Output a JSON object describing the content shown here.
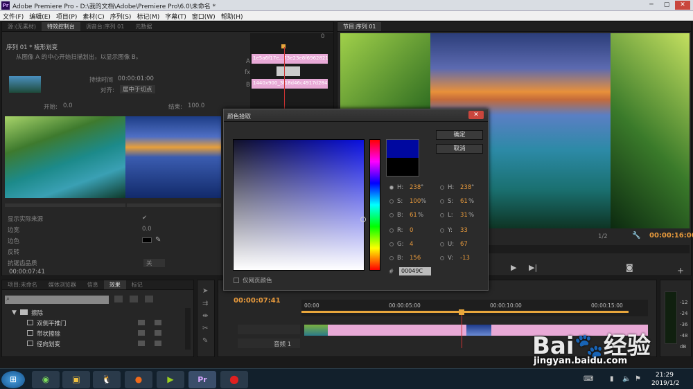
{
  "window": {
    "title": "Adobe Premiere Pro - D:\\我的文档\\Adobe\\Premiere Pro\\6.0\\未命名 *",
    "logo": "Pr"
  },
  "menu": [
    "文件(F)",
    "编辑(E)",
    "项目(P)",
    "素材(C)",
    "序列(S)",
    "标记(M)",
    "字幕(T)",
    "窗口(W)",
    "帮助(H)"
  ],
  "effect_controls": {
    "tabs": [
      "源:(无素材)",
      "特效控制台",
      "调音台:序列 01",
      "元数据"
    ],
    "header": "序列 01 * 棱形划变",
    "desc": "从图像 A 的中心开始扫描划出，以显示图像 B。",
    "duration_label": "持续时间",
    "duration": "00:00:01:00",
    "align_label": "对齐:",
    "align": "居中于切点",
    "clip_a": "1e5a6f17e...73e23e8f6962821",
    "clip_b": "1440x900_3f18d46c4917d2846",
    "mini_time": "0",
    "track_a": "A",
    "track_fx": "fx",
    "track_b": "B",
    "start_label": "开始:",
    "start_val": "0.0",
    "end_label": "结束:",
    "end_val": "100.0",
    "props": [
      {
        "name": "显示实际来源",
        "val": "✔"
      },
      {
        "name": "边宽",
        "val": "0.0"
      },
      {
        "name": "边色",
        "val": ""
      },
      {
        "name": "反转",
        "val": ""
      },
      {
        "name": "抗锯齿品质",
        "val": "关"
      }
    ],
    "time": "00:00:07:41"
  },
  "program": {
    "tab": "节目:序列 01",
    "fraction": "1/2",
    "time": "00:00:16:00"
  },
  "project": {
    "tabs": [
      "项目:未命名",
      "媒体浏览器",
      "信息",
      "效果",
      "标记"
    ],
    "folder": "擦除",
    "items": [
      "双侧平推门",
      "带状擦除",
      "径向划变"
    ]
  },
  "timeline": {
    "time": "00:00:07:41",
    "ticks": [
      "00:00",
      "00:00:05:00",
      "00:00:10:00",
      "00:00:15:00"
    ],
    "audio_track": "音频 1"
  },
  "meter": {
    "labels": [
      "-12",
      "-24",
      "-36",
      "-48",
      "dB"
    ]
  },
  "dialog": {
    "title": "颜色拾取",
    "ok": "确定",
    "cancel": "取消",
    "web_only": "仅网页颜色",
    "hex_label": "#",
    "hex": "00049C",
    "selected_color": "#0008a0",
    "left": [
      {
        "l": "H:",
        "v": "238",
        "u": "°"
      },
      {
        "l": "S:",
        "v": "100",
        "u": "%"
      },
      {
        "l": "B:",
        "v": "61",
        "u": "%"
      },
      {
        "l": "R:",
        "v": "0",
        "u": ""
      },
      {
        "l": "G:",
        "v": "4",
        "u": ""
      },
      {
        "l": "B:",
        "v": "156",
        "u": ""
      }
    ],
    "right": [
      {
        "l": "H:",
        "v": "238",
        "u": "°"
      },
      {
        "l": "S:",
        "v": "61",
        "u": "%"
      },
      {
        "l": "L:",
        "v": "31",
        "u": "%"
      },
      {
        "l": "Y:",
        "v": "33",
        "u": ""
      },
      {
        "l": "U:",
        "v": "67",
        "u": ""
      },
      {
        "l": "V:",
        "v": "-13",
        "u": ""
      }
    ]
  },
  "watermark": {
    "brand": "Bai",
    "brand2": "经验",
    "url": "jingyan.baidu.com"
  },
  "taskbar": {
    "time": "21:29",
    "date": "2019/1/2"
  }
}
